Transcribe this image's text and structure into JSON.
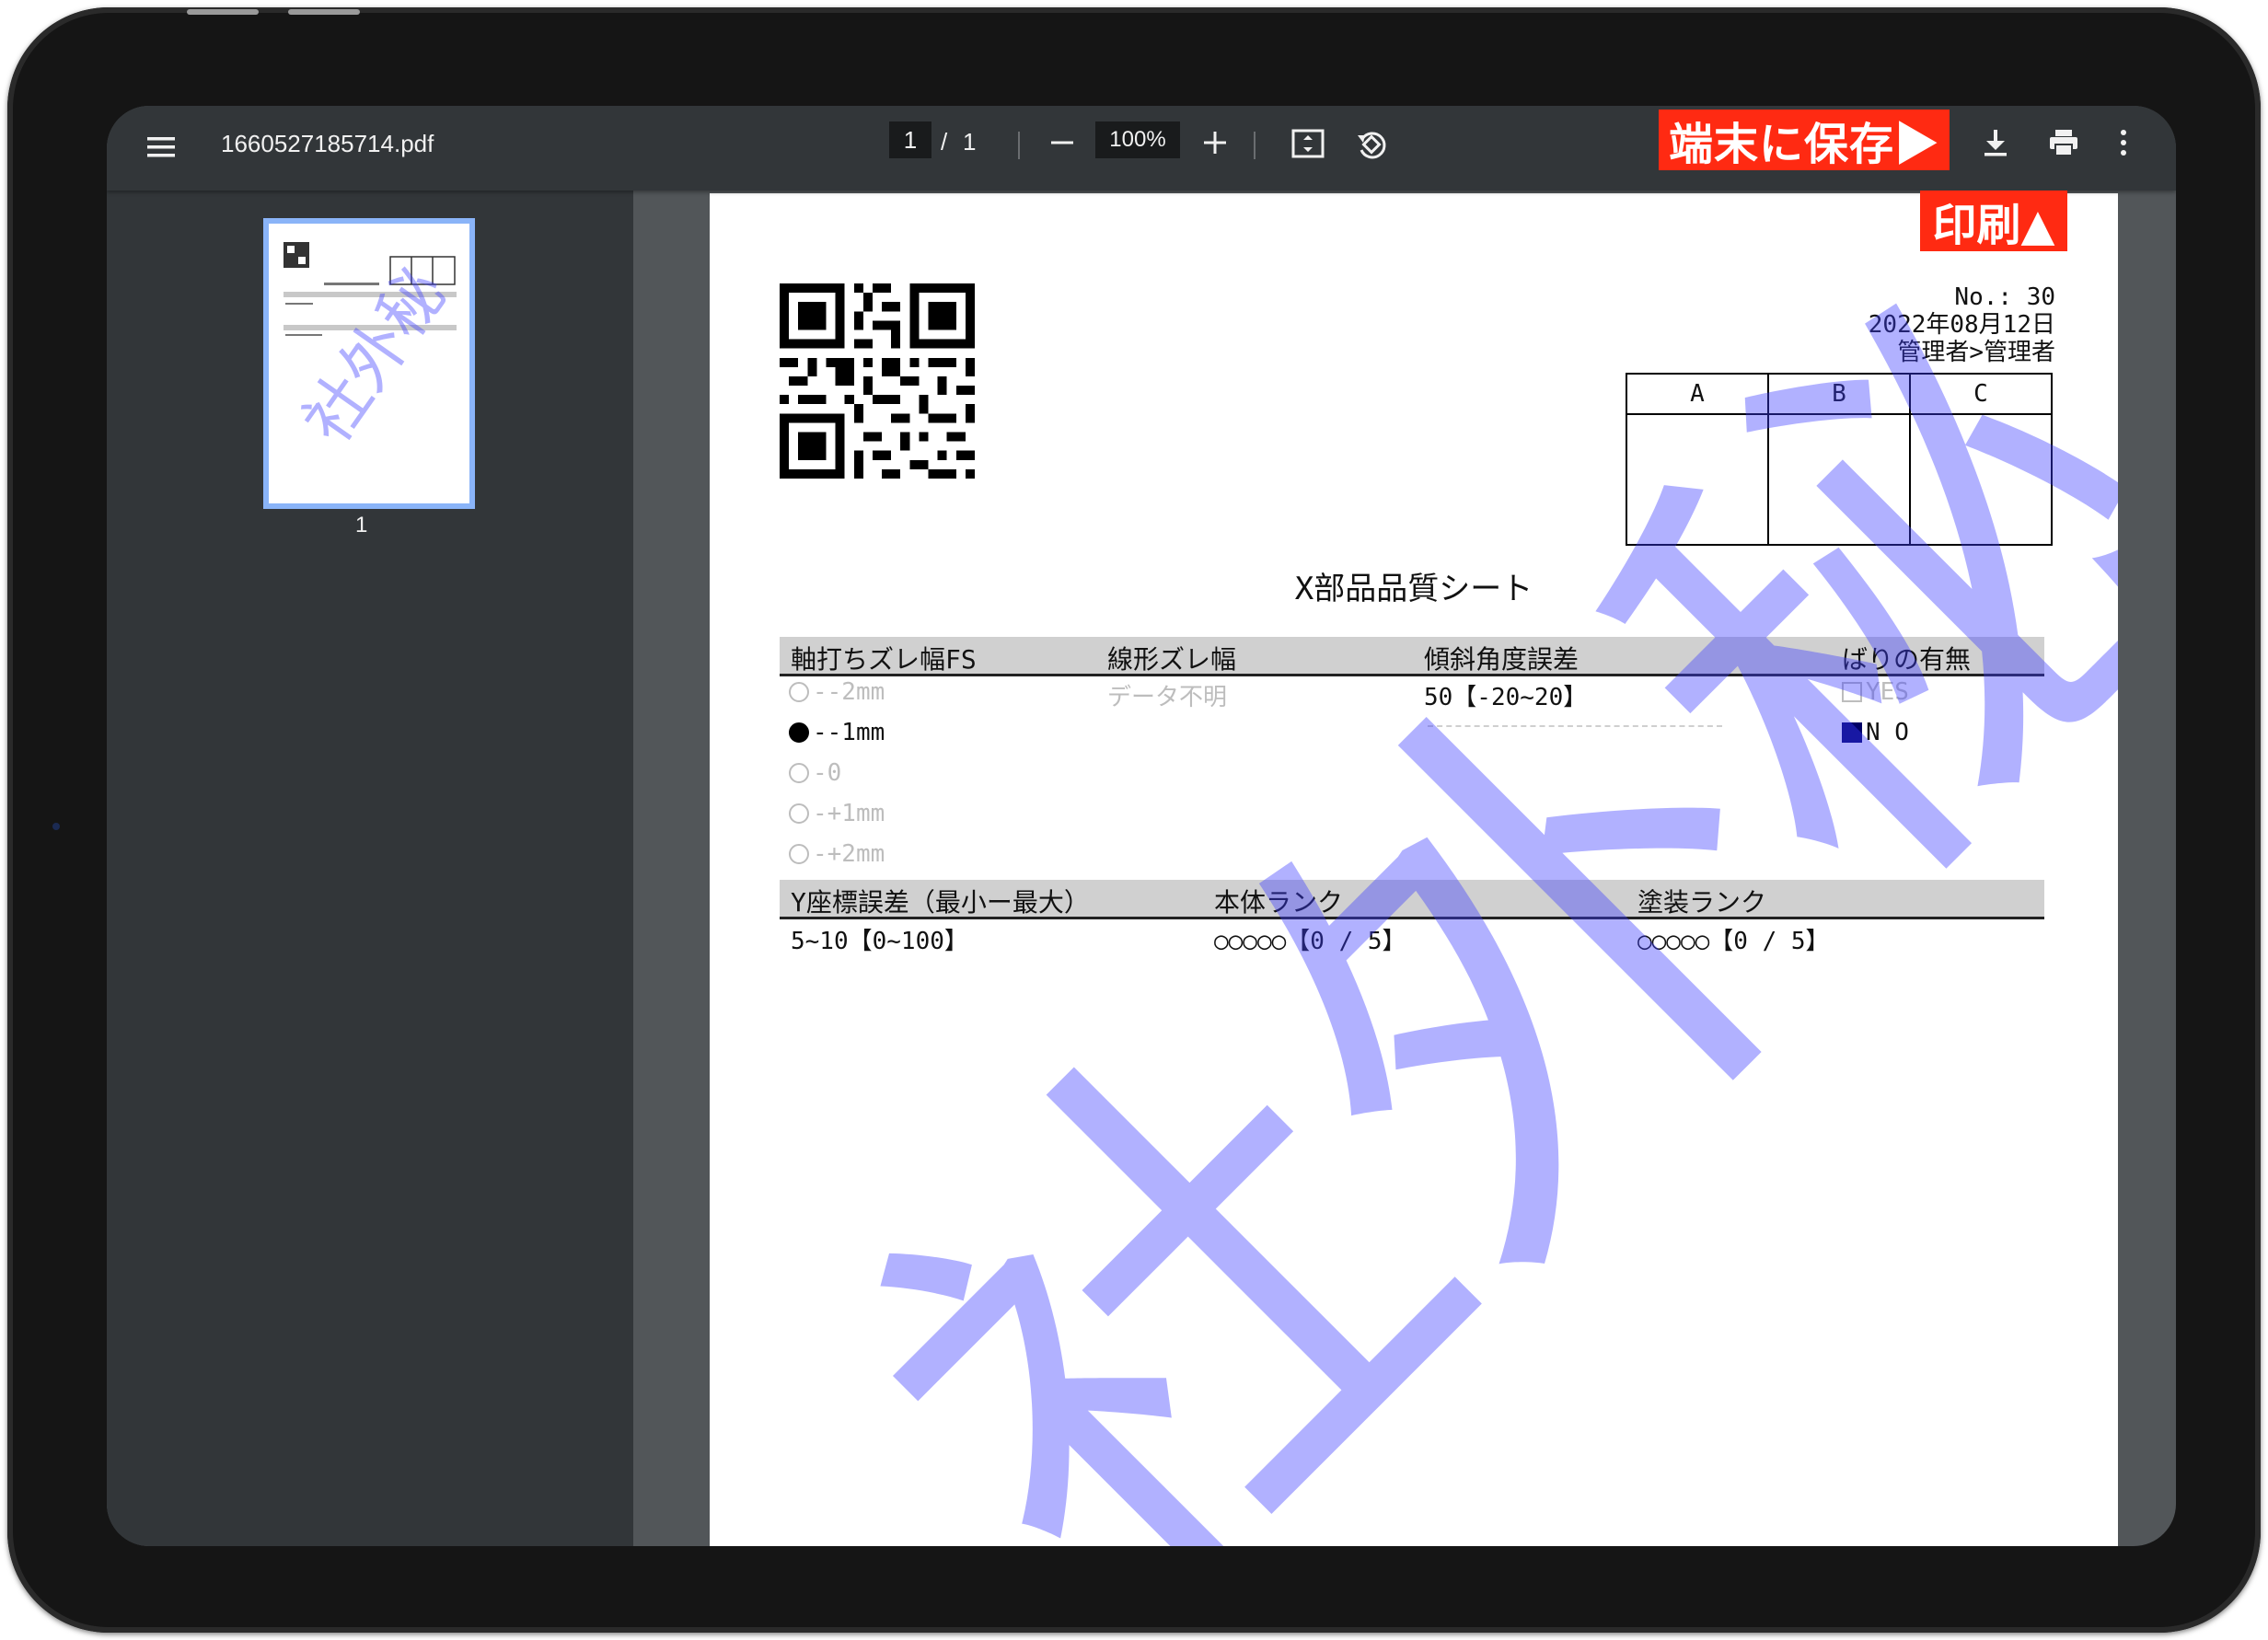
{
  "viewer": {
    "file_name": "1660527185714.pdf",
    "current_page": "1",
    "page_separator": "/",
    "total_pages": "1",
    "zoom": "100%",
    "thumbnail_label": "1"
  },
  "icons": {
    "menu": "menu-icon",
    "zoom_out": "minus-icon",
    "zoom_in": "plus-icon",
    "fit": "fit-page-icon",
    "rotate": "rotate-icon",
    "download": "download-icon",
    "print": "print-icon",
    "more": "more-vertical-icon"
  },
  "annotations": {
    "save_label": "端末に保存▶",
    "print_label": "印刷▲",
    "color": "#ff2a12"
  },
  "document": {
    "no_line": "No.: 30",
    "date_line": "2022年08月12日",
    "admin_line": "管理者>管理者",
    "approval_headers": [
      "A",
      "B",
      "C"
    ],
    "title": "X部品品質シート",
    "section1": {
      "headers": [
        "軸打ちズレ幅FS",
        "線形ズレ幅",
        "傾斜角度誤差",
        "ばりの有無"
      ],
      "radio_options": [
        {
          "label": "--2mm",
          "selected": false
        },
        {
          "label": "--1mm",
          "selected": true
        },
        {
          "label": "-0",
          "selected": false
        },
        {
          "label": "-+1mm",
          "selected": false
        },
        {
          "label": "-+2mm",
          "selected": false
        }
      ],
      "linear_value": "データ不明",
      "angle_value": "50【-20~20】",
      "burr_options": [
        {
          "label": "YES",
          "checked": false
        },
        {
          "label": "N O",
          "checked": true
        }
      ]
    },
    "section2": {
      "headers": [
        "Y座標誤差（最小ー最大）",
        "本体ランク",
        "塗装ランク"
      ],
      "y_error_value": "5~10【0~100】",
      "body_rank_value": "○○○○○【0 / 5】",
      "coating_rank_value": "○○○○○【0 / 5】"
    },
    "watermark": "社外秘",
    "watermark_color": "#3c3cff"
  }
}
